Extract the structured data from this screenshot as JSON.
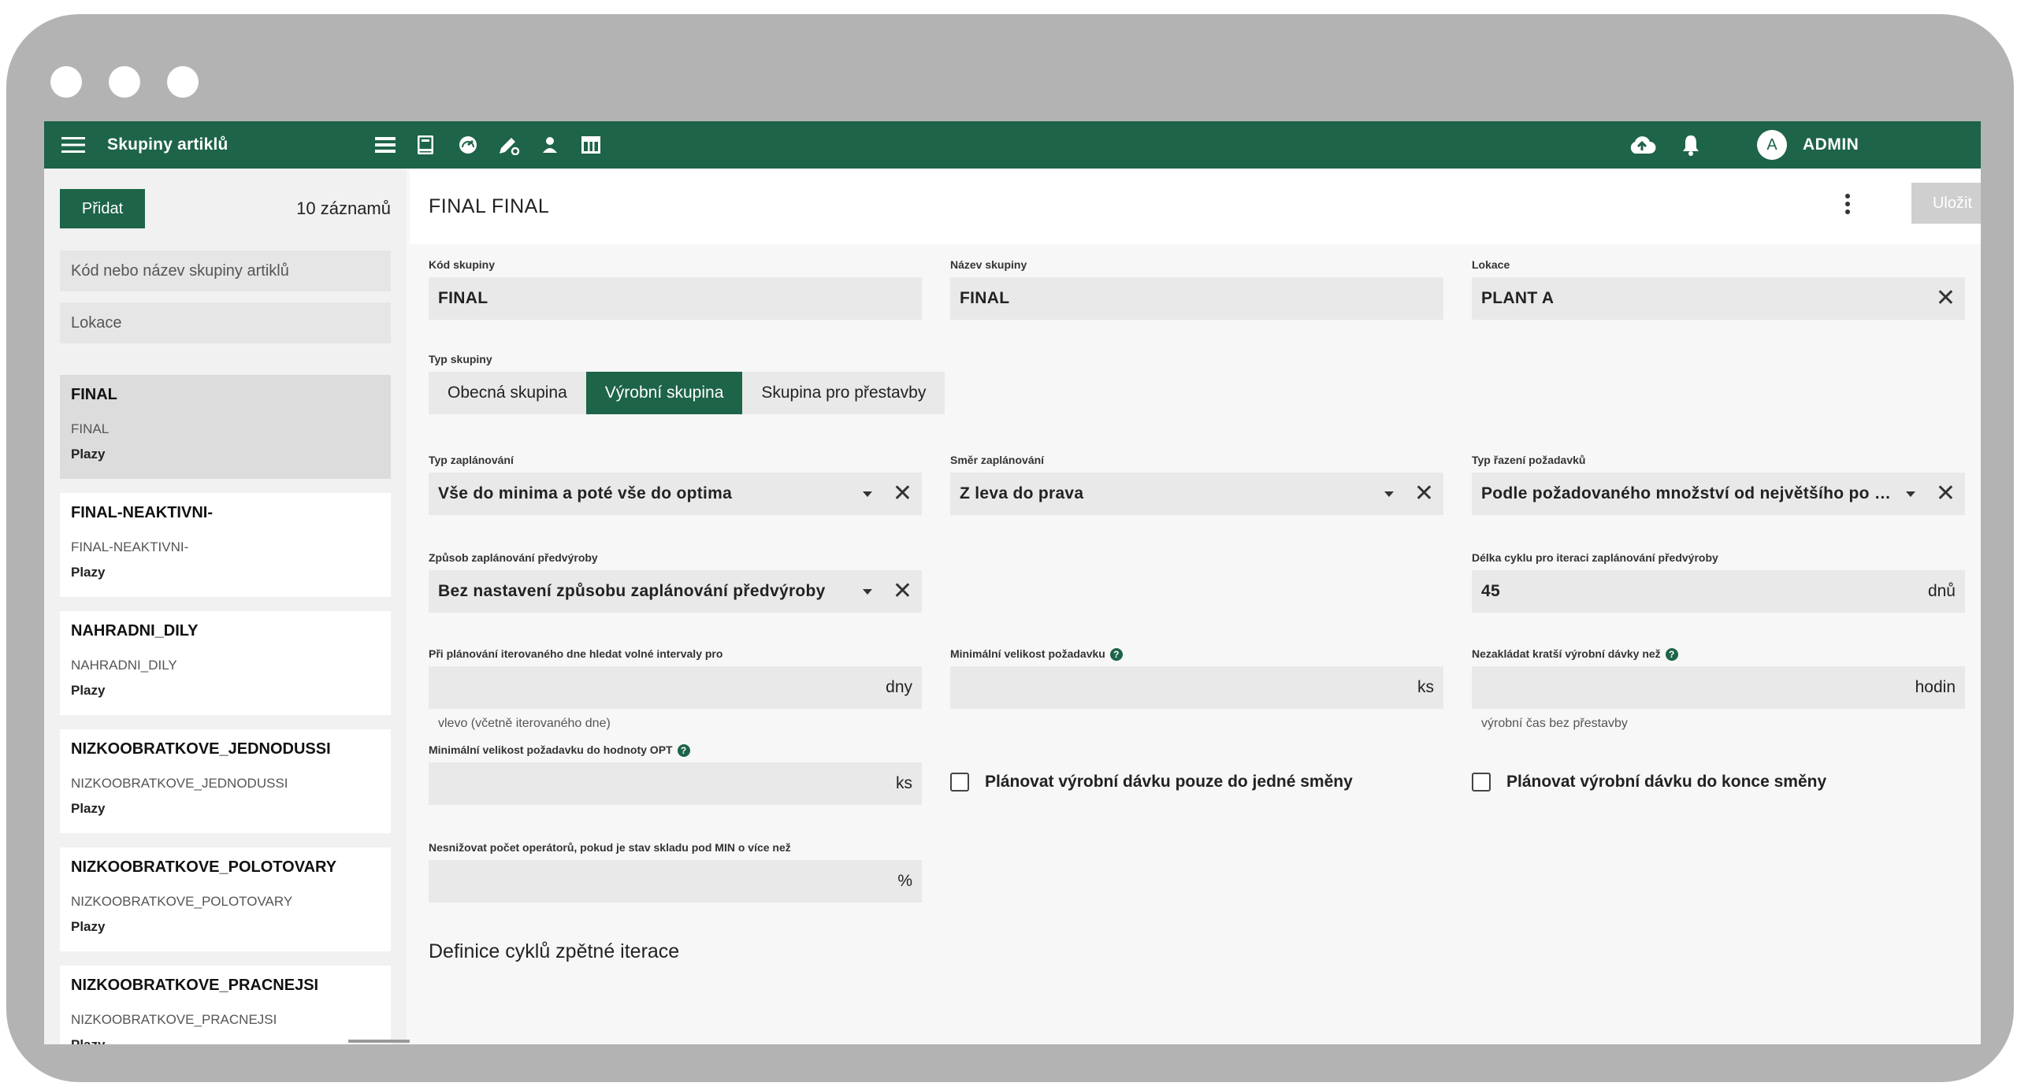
{
  "app": {
    "title": "Skupiny artiklů",
    "user_initial": "A",
    "user_name": "ADMIN",
    "accent_color": "#1d6448",
    "icons": [
      "menu-icon",
      "list-icon",
      "book-icon",
      "gauge-icon",
      "edit-icon",
      "person-icon",
      "table-icon",
      "cloud-upload-icon",
      "bell-icon",
      "chevron-down-icon"
    ]
  },
  "sidebar": {
    "add_label": "Přidat",
    "count": "10 záznamů",
    "search_placeholder": "Kód nebo název skupiny artiklů",
    "location_placeholder": "Lokace",
    "items": [
      {
        "title": "FINAL",
        "code": "FINAL",
        "location": "Plazy",
        "selected": true
      },
      {
        "title": "FINAL-NEAKTIVNI-",
        "code": "FINAL-NEAKTIVNI-",
        "location": "Plazy"
      },
      {
        "title": "NAHRADNI_DILY",
        "code": "NAHRADNI_DILY",
        "location": "Plazy"
      },
      {
        "title": "NIZKOOBRATKOVE_JEDNODUSSI",
        "code": "NIZKOOBRATKOVE_JEDNODUSSI",
        "location": "Plazy"
      },
      {
        "title": "NIZKOOBRATKOVE_POLOTOVARY",
        "code": "NIZKOOBRATKOVE_POLOTOVARY",
        "location": "Plazy"
      },
      {
        "title": "NIZKOOBRATKOVE_PRACNEJSI",
        "code": "NIZKOOBRATKOVE_PRACNEJSI",
        "location": "Plazy"
      }
    ]
  },
  "main": {
    "page_title": "FINAL  FINAL",
    "save_label": "Uložit",
    "group_code": {
      "label": "Kód skupiny",
      "value": "FINAL"
    },
    "group_name": {
      "label": "Název skupiny",
      "value": "FINAL"
    },
    "location": {
      "label": "Lokace",
      "value": "PLANT A"
    },
    "group_type": {
      "label": "Typ skupiny",
      "options": [
        "Obecná skupina",
        "Výrobní skupina",
        "Skupina pro přestavby"
      ],
      "selected": "Výrobní skupina"
    },
    "planning_type": {
      "label": "Typ zaplánování",
      "value": "Vše do minima a poté vše do optima"
    },
    "planning_direction": {
      "label": "Směr zaplánování",
      "value": "Z leva do prava"
    },
    "request_sort": {
      "label": "Typ řazení požadavků",
      "value": "Podle požadovaného množství od největšího po nejmenší"
    },
    "preproduction_method": {
      "label": "Způsob zaplánování předvýroby",
      "value": "Bez nastavení způsobu zaplánování předvýroby"
    },
    "cycle_length": {
      "label": "Délka cyklu pro iteraci zaplánování předvýroby",
      "value": "45",
      "unit": "dnů"
    },
    "free_intervals": {
      "label": "Při plánování iterovaného dne hledat volné intervaly pro",
      "value": "",
      "unit": "dny",
      "hint": "vlevo (včetně iterovaného dne)"
    },
    "min_request": {
      "label": "Minimální velikost požadavku",
      "value": "",
      "unit": "ks"
    },
    "min_batch": {
      "label": "Nezakládat kratší výrobní dávky než",
      "value": "",
      "unit": "hodin",
      "hint": "výrobní čas bez přestavby"
    },
    "min_request_opt": {
      "label": "Minimální velikost požadavku do hodnoty OPT",
      "value": "",
      "unit": "ks"
    },
    "one_shift_checkbox": {
      "label": "Plánovat výrobní dávku pouze do jedné směny",
      "checked": false
    },
    "end_shift_checkbox": {
      "label": "Plánovat výrobní dávku do konce směny",
      "checked": false
    },
    "operators": {
      "label": "Nesnižovat počet operátorů, pokud je stav skladu pod MIN o více než",
      "value": "",
      "unit": "%"
    },
    "section_title": "Definice cyklů zpětné iterace"
  }
}
